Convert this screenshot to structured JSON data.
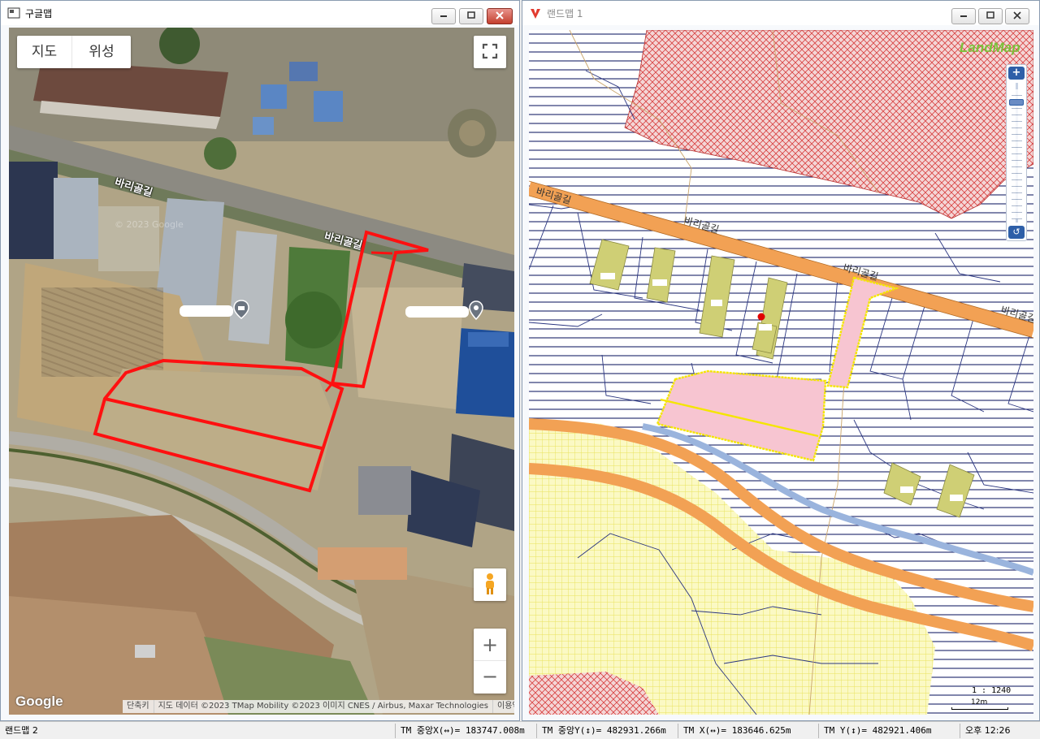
{
  "left_window": {
    "title": "구글맵",
    "controls": {
      "minimize": "▭",
      "maximize": "▢",
      "close": "✕"
    },
    "map_type_buttons": [
      "지도",
      "위성"
    ],
    "fullscreen_icon": "fullscreen-icon",
    "pegman_icon": "pegman-icon",
    "zoom_in": "+",
    "zoom_out": "−",
    "logo": "Google",
    "road_labels": [
      "바리골길",
      "바리골길"
    ],
    "watermark": "© 2023 Google",
    "attribution": {
      "shortcuts": "단축키",
      "data": "지도 데이터 ©2023 TMap Mobility ©2023 이미지 CNES / Airbus, Maxar Technologies",
      "terms": "이용약관"
    }
  },
  "right_window": {
    "title": "랜드맵 1",
    "controls": {
      "minimize": "▭",
      "maximize": "▢",
      "close": "✕"
    },
    "logo": "LandMap",
    "zoom_plus": "+",
    "zoom_reset": "↺",
    "road_labels": [
      "바리골길",
      "바리골길",
      "바리골길",
      "바리골길"
    ],
    "scale_ratio": "1 : 1240",
    "scale_bar": "12m",
    "colors": {
      "road": "#f2a154",
      "hatch": "#1a2468",
      "red_zone": "#d84040",
      "yellow_zone": "#f2ef90",
      "parcel_pink": "#f7c5d1",
      "building": "#cfcf75"
    }
  },
  "status_bar": {
    "app_name": "랜드맵 2",
    "center_x": "TM 중앙X(↔)= 183747.008m",
    "center_y": "TM 중앙Y(↕)= 482931.266m",
    "tm_x": "TM X(↔)= 183646.625m",
    "tm_y": "TM Y(↕)= 482921.406m",
    "time": "오후 12:26"
  }
}
